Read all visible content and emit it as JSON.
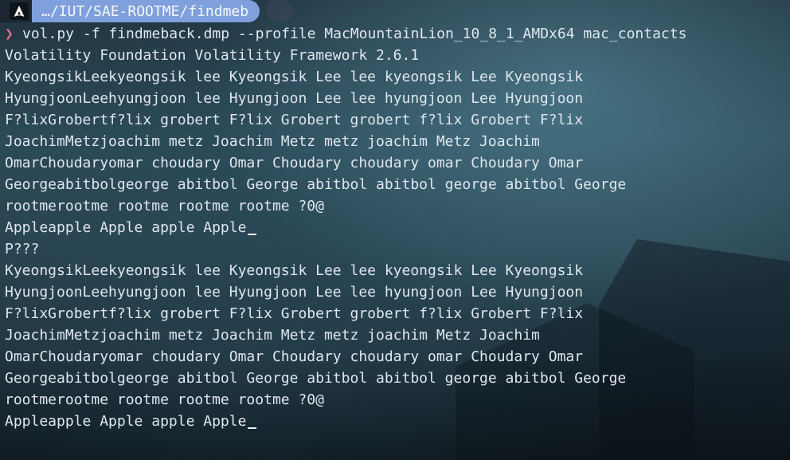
{
  "prompt": {
    "os_icon": "arch-linux-icon",
    "path": "…/IUT/SAE-ROOTME/findmeb"
  },
  "command": {
    "chevron": "❯",
    "text": "vol.py -f findmeback.dmp --profile MacMountainLion_10_8_1_AMDx64 mac_contacts"
  },
  "output_lines": [
    "Volatility Foundation Volatility Framework 2.6.1",
    "KyeongsikLeekyeongsik lee Kyeongsik Lee lee kyeongsik Lee Kyeongsik",
    "HyungjoonLeehyungjoon lee Hyungjoon Lee lee hyungjoon Lee Hyungjoon",
    "F?lixGrobertf?lix grobert F?lix Grobert grobert f?lix Grobert F?lix",
    "JoachimMetzjoachim metz Joachim Metz metz joachim Metz Joachim",
    "OmarChoudaryomar choudary Omar Choudary choudary omar Choudary Omar",
    "Georgeabitbolgeorge abitbol George abitbol abitbol george abitbol George",
    "rootmerootme rootme rootme rootme ?0@",
    "Appleapple Apple apple Apple",
    "P???",
    "KyeongsikLeekyeongsik lee Kyeongsik Lee lee kyeongsik Lee Kyeongsik",
    "HyungjoonLeehyungjoon lee Hyungjoon Lee lee hyungjoon Lee Hyungjoon",
    "F?lixGrobertf?lix grobert F?lix Grobert grobert f?lix Grobert F?lix",
    "JoachimMetzjoachim metz Joachim Metz metz joachim Metz Joachim",
    "OmarChoudaryomar choudary Omar Choudary choudary omar Choudary Omar",
    "Georgeabitbolgeorge abitbol George abitbol abitbol george abitbol George",
    "rootmerootme rootme rootme rootme ?0@",
    "Appleapple Apple apple Apple"
  ],
  "cursor_lines": [
    8,
    17
  ]
}
